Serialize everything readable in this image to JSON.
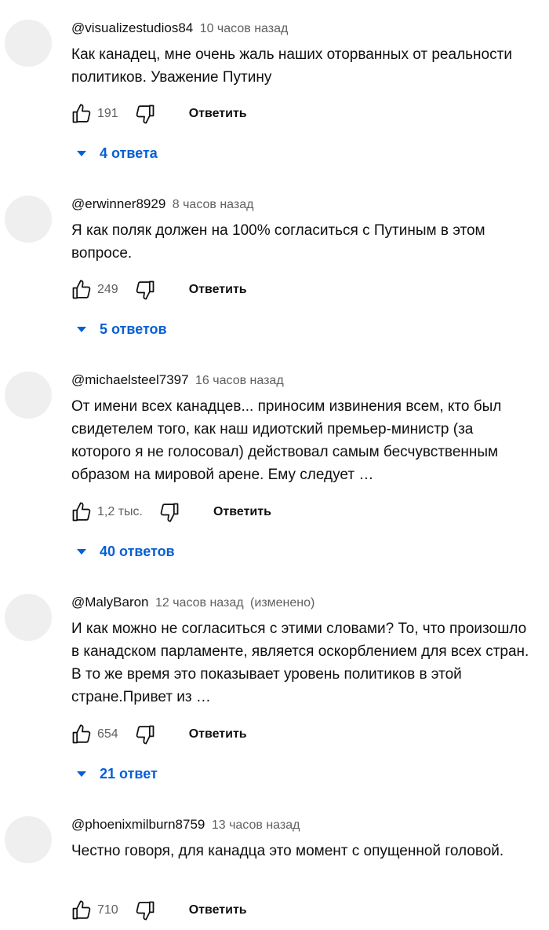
{
  "ui": {
    "reply_label": "Ответить",
    "like_icon": "thumb-up-outline",
    "dislike_icon": "thumb-down-outline",
    "accent": "#065fd4"
  },
  "comments": [
    {
      "author": "@visualizestudios84",
      "time": "10 часов назад",
      "edited": "",
      "text": "Как канадец, мне очень жаль наших оторванных от реальности политиков. Уважение Путину",
      "likes": "191",
      "replies": "4 ответа"
    },
    {
      "author": "@erwinner8929",
      "time": "8 часов назад",
      "edited": "",
      "text": "Я как поляк должен на 100% согласиться с Путиным в этом вопросе.",
      "likes": "249",
      "replies": "5 ответов"
    },
    {
      "author": "@michaelsteel7397",
      "time": "16 часов назад",
      "edited": "",
      "text": "От имени всех канадцев... приносим извинения всем, кто был свидетелем того, как наш идиотский премьер-министр (за которого я не голосовал) действовал самым бесчувственным образом на мировой арене. Ему следует …",
      "likes": "1,2 тыс.",
      "replies": "40 ответов"
    },
    {
      "author": "@MalyBaron",
      "time": "12 часов назад",
      "edited": "(изменено)",
      "text": "И как можно не согласиться с этими словами? То, что произошло в канадском парламенте, является оскорблением для всех стран. В то же время это показывает уровень политиков в этой стране.Привет из …",
      "likes": "654",
      "replies": "21 ответ"
    },
    {
      "author": "@phoenixmilburn8759",
      "time": "13 часов назад",
      "edited": "",
      "text": "Честно говоря, для канадца это момент с опущенной головой.",
      "likes": "710",
      "replies": ""
    }
  ]
}
